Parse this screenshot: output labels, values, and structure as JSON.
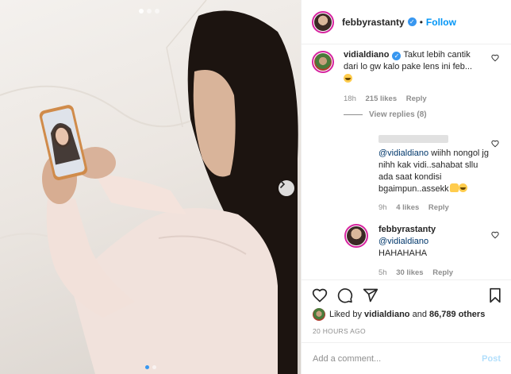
{
  "post": {
    "author": "febbyrastanty",
    "follow_label": "Follow",
    "separator": "•"
  },
  "comments": [
    {
      "username": "vidialdiano",
      "text": "Takut lebih cantik dari lo gw kalo pake lens ini feb...",
      "time": "18h",
      "likes": "215 likes",
      "reply": "Reply"
    }
  ],
  "view_replies": "View replies (8)",
  "replies": [
    {
      "mention": "@vidialdiano",
      "text": "wiihh nongol jg nihh kak vidi..sahabat sllu ada saat kondisi bgaimpun..assekk",
      "time": "9h",
      "likes": "4 likes",
      "reply": "Reply"
    },
    {
      "username": "febbyrastanty",
      "mention": "@vidialdiano",
      "text": "HAHAHAHA",
      "time": "5h",
      "likes": "30 likes",
      "reply": "Reply"
    }
  ],
  "likes_line": {
    "prefix": "Liked by",
    "user": "vidialdiano",
    "middle": "and",
    "count": "86,789 others"
  },
  "timestamp": "20 HOURS AGO",
  "add_comment": {
    "placeholder": "Add a comment...",
    "post_label": "Post"
  },
  "icons": {
    "verified": "verified-badge-icon",
    "heart": "heart-icon",
    "comment": "comment-icon",
    "share": "share-icon",
    "save": "bookmark-icon",
    "next": "chevron-right-icon"
  },
  "colors": {
    "link": "#0095f6",
    "verified": "#3897f0",
    "muted": "#8e8e8e"
  }
}
